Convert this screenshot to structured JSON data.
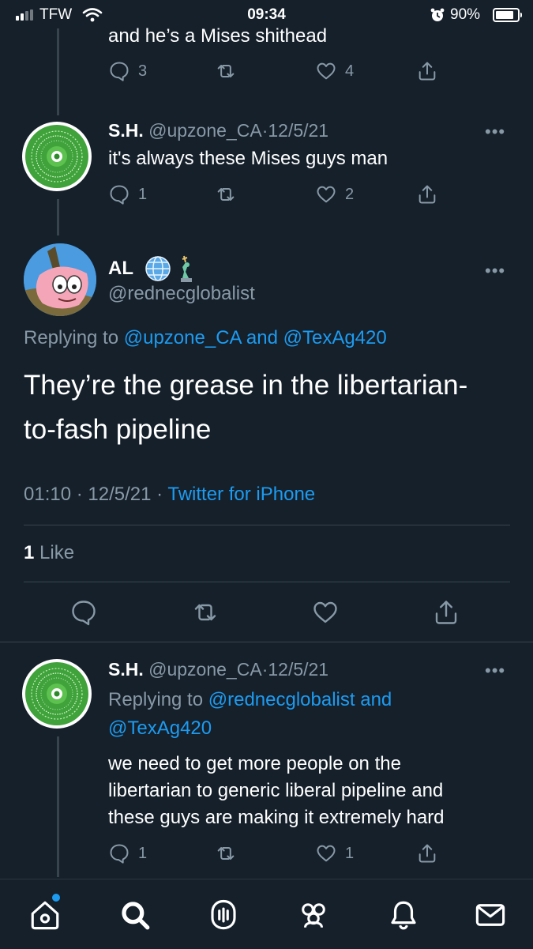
{
  "status_bar": {
    "carrier": "TFW",
    "time": "09:34",
    "battery": "90%",
    "battery_level": 0.9
  },
  "tweets": [
    {
      "text": "and he’s a Mises shithead",
      "replies": "3",
      "likes": "4"
    },
    {
      "name": "S.H.",
      "handle": "@upzone_CA",
      "date": "12/5/21",
      "text": "it's always these Mises guys man",
      "replies": "1",
      "likes": "2"
    },
    {
      "name": "AL",
      "name_emojis": [
        "globe-icon",
        "statue-of-liberty-icon"
      ],
      "handle": "@rednecglobalist",
      "replying_to_prefix": "Replying to",
      "replying_to_1": "@upzone_CA",
      "replying_to_and": "and",
      "replying_to_2": "@TexAg420",
      "text_line1": "They’re the grease in the libertarian-",
      "text_line2": "to-fash pipeline",
      "time": "01:10",
      "date": "12/5/21",
      "client": "Twitter for iPhone",
      "like_count": "1",
      "like_label": "Like"
    },
    {
      "name": "S.H.",
      "handle": "@upzone_CA",
      "date": "12/5/21",
      "replying_to_prefix": "Replying to",
      "replying_to_1": "@rednecglobalist",
      "replying_to_and": "and",
      "replying_to_2": "@TexAg420",
      "text_line1": "we need to get more people on the",
      "text_line2": "libertarian to generic liberal pipeline and",
      "text_line3": "these guys are making it extremely hard",
      "replies": "1",
      "likes": "1"
    }
  ],
  "separator": "·",
  "more_label": "•••",
  "tab_bar": {
    "tabs": [
      "home-icon",
      "search-icon",
      "spaces-icon",
      "communities-icon",
      "notifications-icon",
      "messages-icon"
    ],
    "home_has_dot": true
  },
  "colors": {
    "background": "#15202b",
    "accent": "#1d9bf0",
    "muted": "#8899a6",
    "divider": "#38444d"
  }
}
